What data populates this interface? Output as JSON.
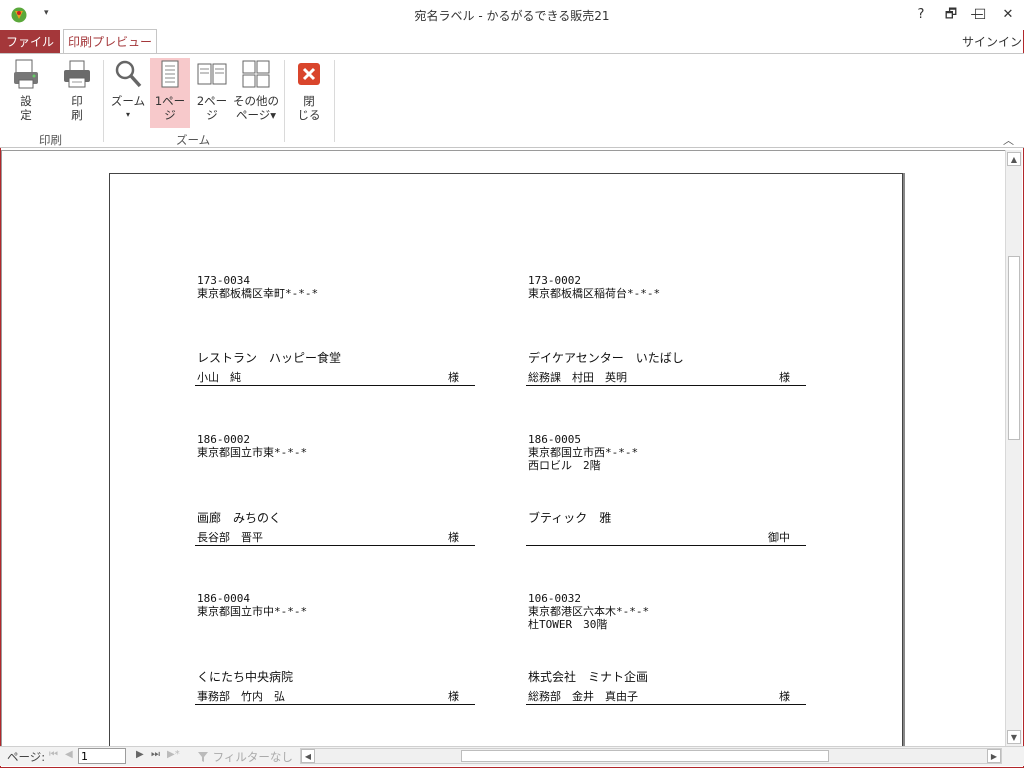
{
  "window": {
    "title": "宛名ラベル - かるがるできる販売21",
    "help": "?",
    "restore": "🗗",
    "minimize": "—",
    "maximize": "☐",
    "close": "✕",
    "qat_arrow": "▾"
  },
  "tabs": {
    "file": "ファイル",
    "print_preview": "印刷プレビュー",
    "signin": "サインイン"
  },
  "ribbon": {
    "settings": {
      "line1": "設",
      "line2": "定"
    },
    "print": {
      "line1": "印",
      "line2": "刷"
    },
    "zoom": {
      "line1": "ズーム",
      "line2": "▾"
    },
    "one_page": {
      "line1": "1ペー",
      "line2": "ジ"
    },
    "two_page": {
      "line1": "2ペー",
      "line2": "ジ"
    },
    "more_pages": {
      "line1": "その他の",
      "line2": "ページ▾"
    },
    "close": {
      "line1": "閉",
      "line2": "じる"
    },
    "group_print": "印刷",
    "group_zoom": "ズーム",
    "collapse": "︿",
    "accent_color": "#a4373a",
    "active_bg": "#f7c9cb"
  },
  "labels": [
    {
      "zip": "173-0034",
      "address": "東京都板橋区幸町*-*-*",
      "address2": "",
      "company": "レストラン　ハッピー食堂",
      "person": "小山　純",
      "honorific": "様"
    },
    {
      "zip": "173-0002",
      "address": "東京都板橋区稲荷台*-*-*",
      "address2": "",
      "company": "デイケアセンター　いたばし",
      "person": "総務課　村田　英明",
      "honorific": "様"
    },
    {
      "zip": "186-0002",
      "address": "東京都国立市東*-*-*",
      "address2": "",
      "company": "画廊　みちのく",
      "person": "長谷部　晋平",
      "honorific": "様"
    },
    {
      "zip": "186-0005",
      "address": "東京都国立市西*-*-*",
      "address2": "西ロビル　2階",
      "company": "ブティック　雅",
      "person": "",
      "honorific": "御中"
    },
    {
      "zip": "186-0004",
      "address": "東京都国立市中*-*-*",
      "address2": "",
      "company": "くにたち中央病院",
      "person": "事務部　竹内　弘",
      "honorific": "様"
    },
    {
      "zip": "106-0032",
      "address": "東京都港区六本木*-*-*",
      "address2": "杜TOWER　30階",
      "company": "株式会社　ミナト企画",
      "person": "総務部　金井　真由子",
      "honorific": "様"
    }
  ],
  "navigation": {
    "page_label": "ページ:",
    "first": "⏮",
    "prev": "◀",
    "page_value": "1",
    "next": "▶",
    "last": "⏭",
    "new": "▶*",
    "filter": "フィルターなし",
    "scroll_left": "◀",
    "scroll_right": "▶",
    "scroll_up": "▲",
    "scroll_down": "▼"
  }
}
